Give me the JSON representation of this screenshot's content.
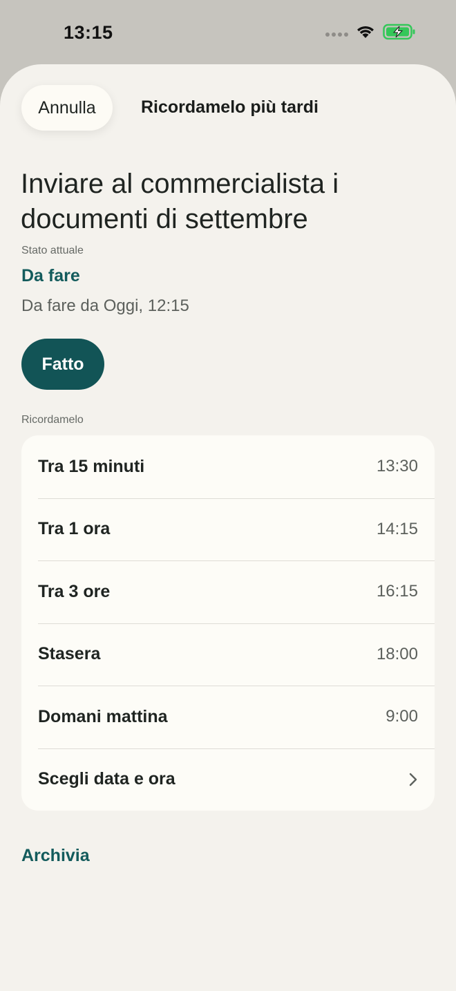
{
  "status_bar": {
    "time": "13:15",
    "icons": [
      "signal-dots-icon",
      "wifi-icon",
      "battery-charging-icon"
    ],
    "battery_color": "#34c759"
  },
  "header": {
    "cancel_label": "Annulla",
    "title": "Ricordamelo più tardi"
  },
  "task": {
    "title": "Inviare al commercialista i documenti di settembre",
    "state_label": "Stato attuale",
    "state_value": "Da fare",
    "state_since": "Da fare da Oggi, 12:15",
    "done_label": "Fatto"
  },
  "remind": {
    "section_label": "Ricordamelo",
    "options": [
      {
        "label": "Tra 15 minuti",
        "time": "13:30"
      },
      {
        "label": "Tra 1 ora",
        "time": "14:15"
      },
      {
        "label": "Tra 3 ore",
        "time": "16:15"
      },
      {
        "label": "Stasera",
        "time": "18:00"
      },
      {
        "label": "Domani mattina",
        "time": "9:00"
      }
    ],
    "custom_label": "Scegli data e ora",
    "custom_icon": "chevron-right-icon"
  },
  "archive_label": "Archivia",
  "colors": {
    "accent": "#135b5c",
    "button": "#125456",
    "sheet_bg": "#f4f2ed",
    "card_bg": "#fdfcf7"
  }
}
